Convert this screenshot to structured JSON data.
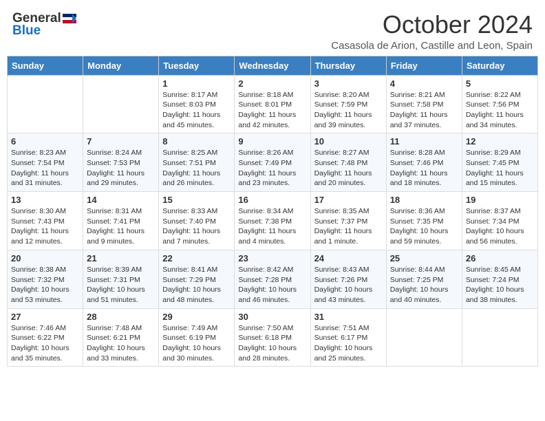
{
  "header": {
    "logo_general": "General",
    "logo_blue": "Blue",
    "month_title": "October 2024",
    "location": "Casasola de Arion, Castille and Leon, Spain"
  },
  "weekdays": [
    "Sunday",
    "Monday",
    "Tuesday",
    "Wednesday",
    "Thursday",
    "Friday",
    "Saturday"
  ],
  "weeks": [
    [
      {
        "day": "",
        "detail": ""
      },
      {
        "day": "",
        "detail": ""
      },
      {
        "day": "1",
        "detail": "Sunrise: 8:17 AM\nSunset: 8:03 PM\nDaylight: 11 hours and 45 minutes."
      },
      {
        "day": "2",
        "detail": "Sunrise: 8:18 AM\nSunset: 8:01 PM\nDaylight: 11 hours and 42 minutes."
      },
      {
        "day": "3",
        "detail": "Sunrise: 8:20 AM\nSunset: 7:59 PM\nDaylight: 11 hours and 39 minutes."
      },
      {
        "day": "4",
        "detail": "Sunrise: 8:21 AM\nSunset: 7:58 PM\nDaylight: 11 hours and 37 minutes."
      },
      {
        "day": "5",
        "detail": "Sunrise: 8:22 AM\nSunset: 7:56 PM\nDaylight: 11 hours and 34 minutes."
      }
    ],
    [
      {
        "day": "6",
        "detail": "Sunrise: 8:23 AM\nSunset: 7:54 PM\nDaylight: 11 hours and 31 minutes."
      },
      {
        "day": "7",
        "detail": "Sunrise: 8:24 AM\nSunset: 7:53 PM\nDaylight: 11 hours and 29 minutes."
      },
      {
        "day": "8",
        "detail": "Sunrise: 8:25 AM\nSunset: 7:51 PM\nDaylight: 11 hours and 26 minutes."
      },
      {
        "day": "9",
        "detail": "Sunrise: 8:26 AM\nSunset: 7:49 PM\nDaylight: 11 hours and 23 minutes."
      },
      {
        "day": "10",
        "detail": "Sunrise: 8:27 AM\nSunset: 7:48 PM\nDaylight: 11 hours and 20 minutes."
      },
      {
        "day": "11",
        "detail": "Sunrise: 8:28 AM\nSunset: 7:46 PM\nDaylight: 11 hours and 18 minutes."
      },
      {
        "day": "12",
        "detail": "Sunrise: 8:29 AM\nSunset: 7:45 PM\nDaylight: 11 hours and 15 minutes."
      }
    ],
    [
      {
        "day": "13",
        "detail": "Sunrise: 8:30 AM\nSunset: 7:43 PM\nDaylight: 11 hours and 12 minutes."
      },
      {
        "day": "14",
        "detail": "Sunrise: 8:31 AM\nSunset: 7:41 PM\nDaylight: 11 hours and 9 minutes."
      },
      {
        "day": "15",
        "detail": "Sunrise: 8:33 AM\nSunset: 7:40 PM\nDaylight: 11 hours and 7 minutes."
      },
      {
        "day": "16",
        "detail": "Sunrise: 8:34 AM\nSunset: 7:38 PM\nDaylight: 11 hours and 4 minutes."
      },
      {
        "day": "17",
        "detail": "Sunrise: 8:35 AM\nSunset: 7:37 PM\nDaylight: 11 hours and 1 minute."
      },
      {
        "day": "18",
        "detail": "Sunrise: 8:36 AM\nSunset: 7:35 PM\nDaylight: 10 hours and 59 minutes."
      },
      {
        "day": "19",
        "detail": "Sunrise: 8:37 AM\nSunset: 7:34 PM\nDaylight: 10 hours and 56 minutes."
      }
    ],
    [
      {
        "day": "20",
        "detail": "Sunrise: 8:38 AM\nSunset: 7:32 PM\nDaylight: 10 hours and 53 minutes."
      },
      {
        "day": "21",
        "detail": "Sunrise: 8:39 AM\nSunset: 7:31 PM\nDaylight: 10 hours and 51 minutes."
      },
      {
        "day": "22",
        "detail": "Sunrise: 8:41 AM\nSunset: 7:29 PM\nDaylight: 10 hours and 48 minutes."
      },
      {
        "day": "23",
        "detail": "Sunrise: 8:42 AM\nSunset: 7:28 PM\nDaylight: 10 hours and 46 minutes."
      },
      {
        "day": "24",
        "detail": "Sunrise: 8:43 AM\nSunset: 7:26 PM\nDaylight: 10 hours and 43 minutes."
      },
      {
        "day": "25",
        "detail": "Sunrise: 8:44 AM\nSunset: 7:25 PM\nDaylight: 10 hours and 40 minutes."
      },
      {
        "day": "26",
        "detail": "Sunrise: 8:45 AM\nSunset: 7:24 PM\nDaylight: 10 hours and 38 minutes."
      }
    ],
    [
      {
        "day": "27",
        "detail": "Sunrise: 7:46 AM\nSunset: 6:22 PM\nDaylight: 10 hours and 35 minutes."
      },
      {
        "day": "28",
        "detail": "Sunrise: 7:48 AM\nSunset: 6:21 PM\nDaylight: 10 hours and 33 minutes."
      },
      {
        "day": "29",
        "detail": "Sunrise: 7:49 AM\nSunset: 6:19 PM\nDaylight: 10 hours and 30 minutes."
      },
      {
        "day": "30",
        "detail": "Sunrise: 7:50 AM\nSunset: 6:18 PM\nDaylight: 10 hours and 28 minutes."
      },
      {
        "day": "31",
        "detail": "Sunrise: 7:51 AM\nSunset: 6:17 PM\nDaylight: 10 hours and 25 minutes."
      },
      {
        "day": "",
        "detail": ""
      },
      {
        "day": "",
        "detail": ""
      }
    ]
  ]
}
